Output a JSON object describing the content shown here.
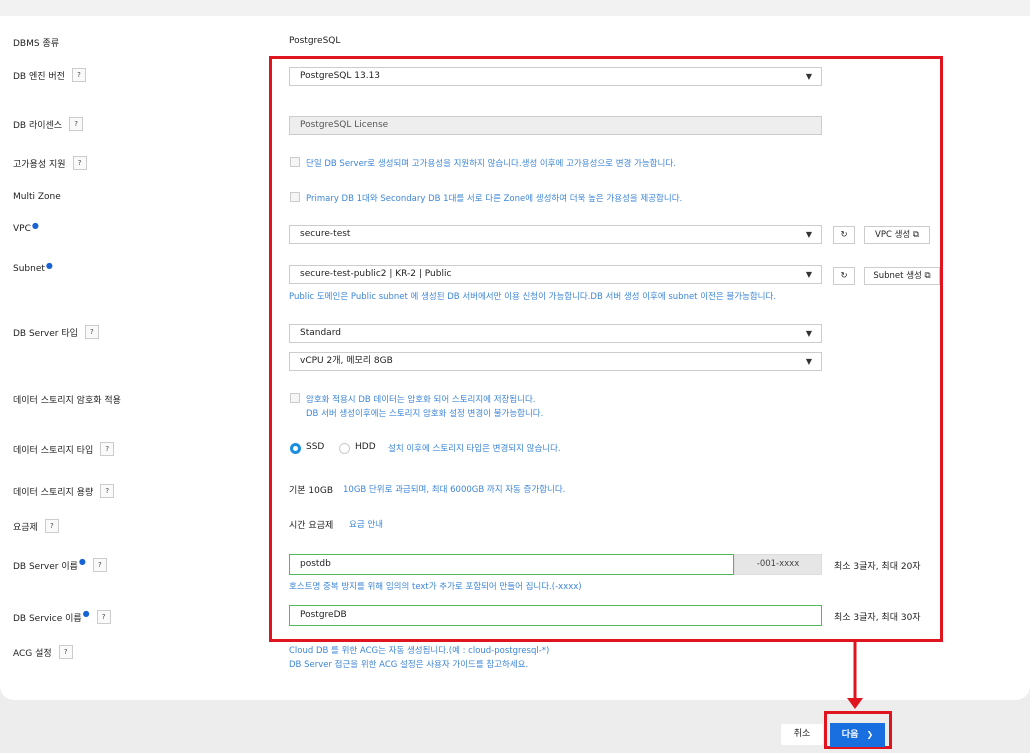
{
  "dbms": {
    "label": "DBMS 종류",
    "value": "PostgreSQL"
  },
  "engine": {
    "label": "DB 엔진 버전",
    "value": "PostgreSQL 13.13"
  },
  "license": {
    "label": "DB 라이센스",
    "value": "PostgreSQL License"
  },
  "ha": {
    "label": "고가용성 지원",
    "text": "단일 DB Server로 생성되며 고가용성을 지원하지 않습니다.생성 이후에 고가용성으로 변경 가능합니다."
  },
  "multizone": {
    "label": "Multi Zone",
    "text": "Primary DB 1대와 Secondary DB 1대를 서로 다른 Zone에 생성하여 더욱 높은 가용성을 제공합니다."
  },
  "vpc": {
    "label": "VPC",
    "value": "secure-test",
    "create_label": "VPC 생성"
  },
  "subnet": {
    "label": "Subnet",
    "value": "secure-test-public2 | KR-2 | Public",
    "create_label": "Subnet 생성",
    "hint": "Public 도메인은 Public subnet 에 생성된 DB 서버에서만 이용 신청이 가능합니다.DB 서버 생성 이후에 subnet 이전은 불가능합니다."
  },
  "server_type": {
    "label": "DB Server 타입",
    "type_value": "Standard",
    "spec_value": "vCPU 2개, 메모리 8GB"
  },
  "encrypt": {
    "label": "데이터 스토리지 암호화 적용",
    "line1": "암호화 적용시 DB 데이터는 암호화 되어 스토리지에 저장됩니다.",
    "line2": "DB 서버 생성이후에는 스토리지 암호화 설정 변경이 불가능합니다."
  },
  "storage_type": {
    "label": "데이터 스토리지 타입",
    "opt_ssd": "SSD",
    "opt_hdd": "HDD",
    "hint": "설치 이후에 스토리지 타입은 변경되지 않습니다.",
    "selected": "SSD"
  },
  "storage_size": {
    "label": "데이터 스토리지 용량",
    "base": "기본 10GB",
    "hint": "10GB 단위로 과금되며, 최대 6000GB 까지 자동 증가합니다."
  },
  "pricing": {
    "label": "요금제",
    "value": "시간 요금제",
    "link": "요금 안내"
  },
  "server_name": {
    "label": "DB Server 이름",
    "value": "postdb",
    "suffix": "-001-xxxx",
    "limit": "최소 3글자, 최대 20자",
    "hint": "호스트명 중복 방지를 위해 임의의 text가 추가로 포함되어 만들어 집니다.(-xxxx)"
  },
  "service_name": {
    "label": "DB Service 이름",
    "value": "PostgreDB",
    "limit": "최소 3글자, 최대 30자"
  },
  "acg": {
    "label": "ACG 설정",
    "line1": "Cloud DB 를 위한 ACG는 자동 생성됩니다.(예 : cloud-postgresql-*)",
    "line2": "DB Server 접근을 위한 ACG 설정은 사용자 가이드를 참고하세요."
  },
  "footer": {
    "cancel_label": "취소",
    "next_label": "다음"
  },
  "icons": {
    "help": "?",
    "caret": "▼",
    "refresh": "↻",
    "external": "⧉",
    "chevron": "❯",
    "required": "●"
  },
  "colors": {
    "hint_blue": "#3d86d8",
    "next_btn": "#1a6fe0",
    "highlight": "#e0141e",
    "input_border": "#52b85d"
  }
}
